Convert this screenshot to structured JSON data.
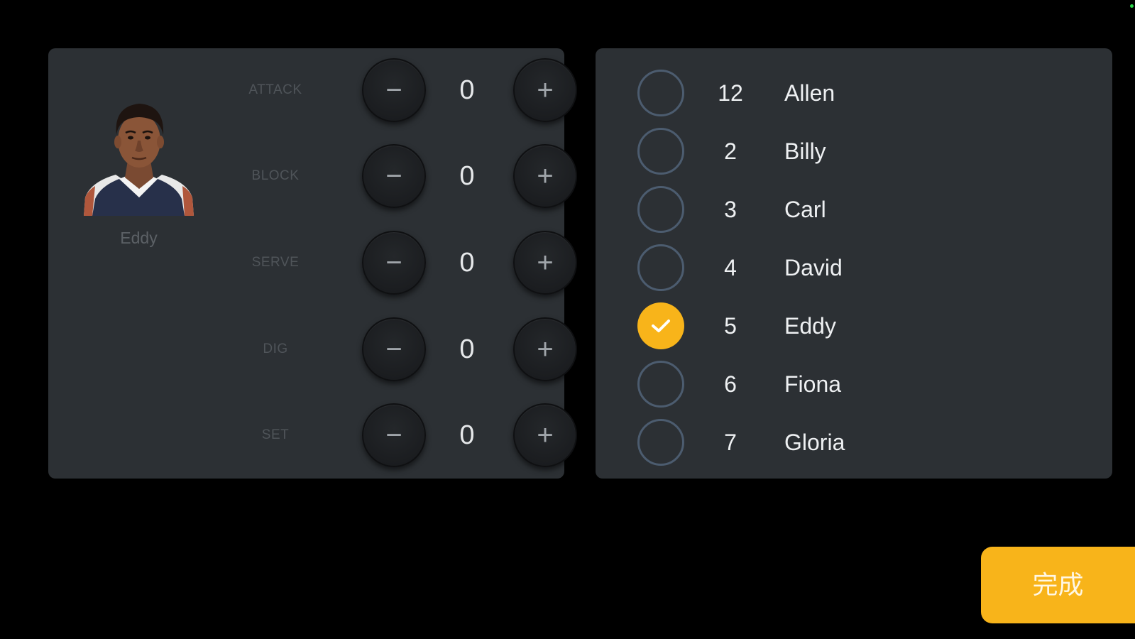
{
  "profile": {
    "name": "Eddy",
    "avatar_icon": "player-portrait"
  },
  "stats": [
    {
      "label": "ATTACK",
      "value": "0",
      "minus": "−",
      "plus": "+"
    },
    {
      "label": "BLOCK",
      "value": "0",
      "minus": "−",
      "plus": "+"
    },
    {
      "label": "SERVE",
      "value": "0",
      "minus": "−",
      "plus": "+"
    },
    {
      "label": "DIG",
      "value": "0",
      "minus": "−",
      "plus": "+"
    },
    {
      "label": "SET",
      "value": "0",
      "minus": "−",
      "plus": "+"
    }
  ],
  "roster": [
    {
      "number": "12",
      "name": "Allen",
      "selected": false
    },
    {
      "number": "2",
      "name": "Billy",
      "selected": false
    },
    {
      "number": "3",
      "name": "Carl",
      "selected": false
    },
    {
      "number": "4",
      "name": "David",
      "selected": false
    },
    {
      "number": "5",
      "name": "Eddy",
      "selected": true
    },
    {
      "number": "6",
      "name": "Fiona",
      "selected": false
    },
    {
      "number": "7",
      "name": "Gloria",
      "selected": false
    }
  ],
  "done_label": "完成",
  "colors": {
    "accent": "#f8b41a",
    "panel": "#2c3034",
    "background": "#000000"
  }
}
